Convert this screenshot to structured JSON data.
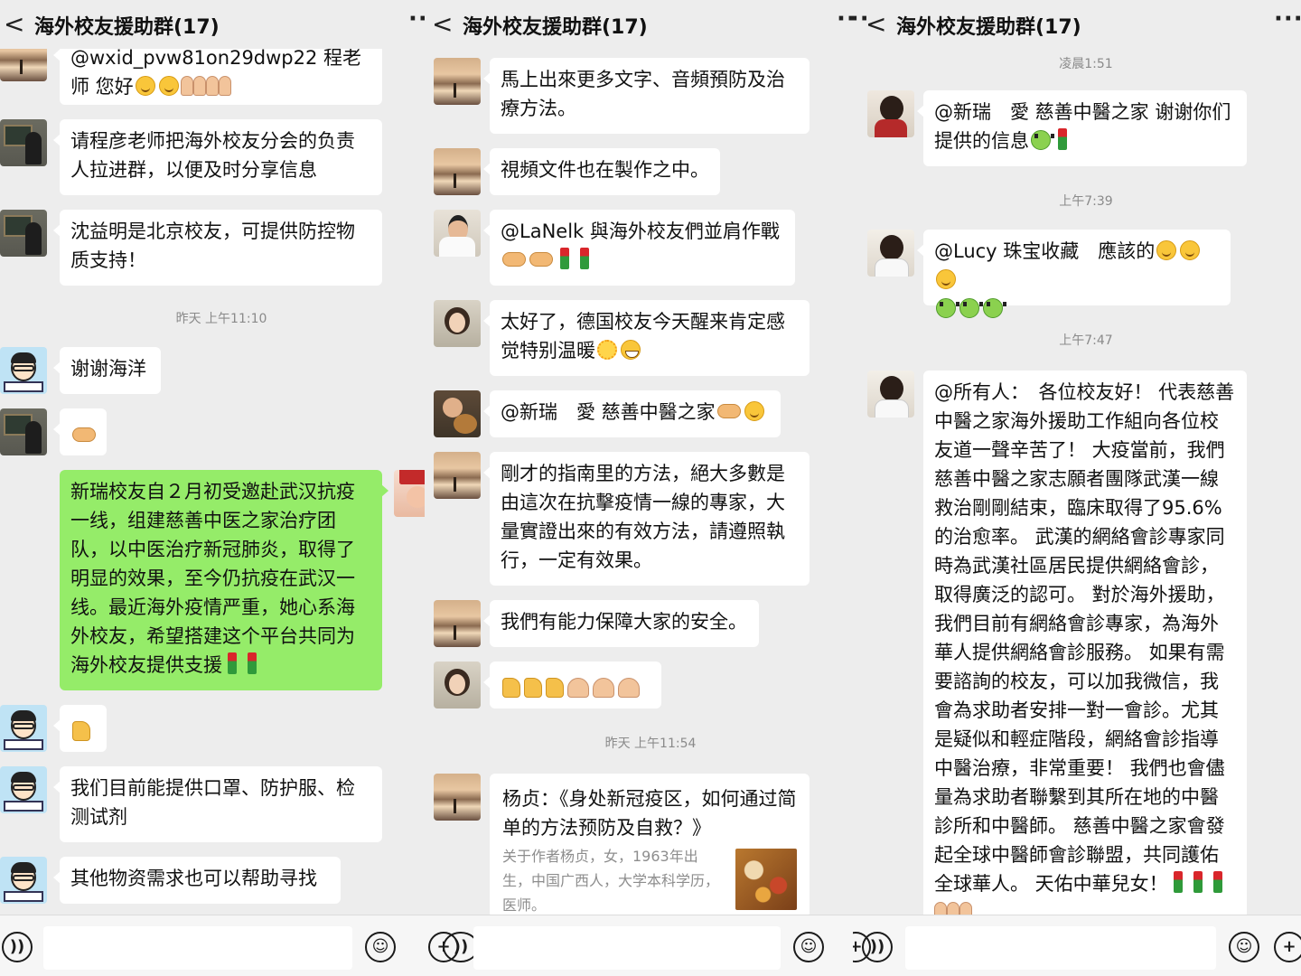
{
  "header": {
    "back": "<",
    "more": "···"
  },
  "panels": [
    {
      "title": "海外校友援助群(17)",
      "messages": [
        {
          "text": "@wxid_pvw81on29dwp22  程老师 您好"
        },
        {
          "text": "请程彦老师把海外校友分会的负责人拉进群，以便及时分享信息"
        },
        {
          "text": "沈益明是北京校友，可提供防控物质支持！"
        },
        {
          "text": "谢谢海洋"
        },
        {
          "text": "新瑞校友自２月初受邀赴武汉抗疫一线，组建慈善中医之家治疗团队，以中医治疗新冠肺炎，取得了明显的效果，至今仍抗疫在武汉一线。最近海外疫情严重，她心系海外校友，希望搭建这个平台共同为海外校友提供支援"
        },
        {
          "text": "我们目前能提供口罩、防护服、检测试剂"
        },
        {
          "text": "其他物资需求也可以帮助寻找"
        }
      ],
      "timestamps": [
        "昨天 上午11:10"
      ]
    },
    {
      "title": "海外校友援助群(17)",
      "messages": [
        {
          "text": "馬上出來更多文字、音頻預防及治療方法。"
        },
        {
          "text": "視頻文件也在製作之中。"
        },
        {
          "text": "@LaNelk  與海外校友們並肩作戰"
        },
        {
          "text": "太好了，德国校友今天醒来肯定感觉特别温暖"
        },
        {
          "text": "@新瑞　愛 慈善中醫之家"
        },
        {
          "text": "剛才的指南里的方法，絕大多數是由這次在抗擊疫情一線的專家，大量實證出來的有效方法，請遵照執行，一定有效果。"
        },
        {
          "text": "我們有能力保障大家的安全。"
        }
      ],
      "timestamps": [
        "昨天 上午11:54"
      ],
      "link": {
        "title": "杨贞：《身处新冠疫区，如何通过简单的方法预防及自救？》",
        "desc": "关于作者杨贞，女，1963年出生，中国广西人，大学本科学历，医师。"
      }
    },
    {
      "title": "海外校友援助群(17)",
      "messages": [
        {
          "text": "@新瑞　愛 慈善中醫之家  谢谢你们提供的信息"
        },
        {
          "text": "@Lucy 珠宝收藏　應該的"
        },
        {
          "text": "@所有人：　各位校友好！ 代表慈善中醫之家海外援助工作組向各位校友道一聲辛苦了！ 大疫當前，我們慈善中醫之家志願者團隊武漢一線救治剛剛結束，臨床取得了95.6% 的治愈率。 武漢的網絡會診專家同時為武漢社區居民提供網絡會診，取得廣泛的認可。 對於海外援助，我們目前有網絡會診專家，為海外華人提供網絡會診服務。 如果有需要諮詢的校友，可以加我微信，我會為求助者安排一對一會診。尤其是疑似和輕症階段，網絡會診指導中醫治療，非常重要！ 我們也會儘量為求助者聯繫到其所在地的中醫診所和中醫師。 慈善中醫之家會發起全球中醫師會診聯盟，共同護佑全球華人。 天佑中華兒女！"
        }
      ],
      "timestamps": [
        "凌晨1:51",
        "上午7:39",
        "上午7:47"
      ]
    }
  ]
}
